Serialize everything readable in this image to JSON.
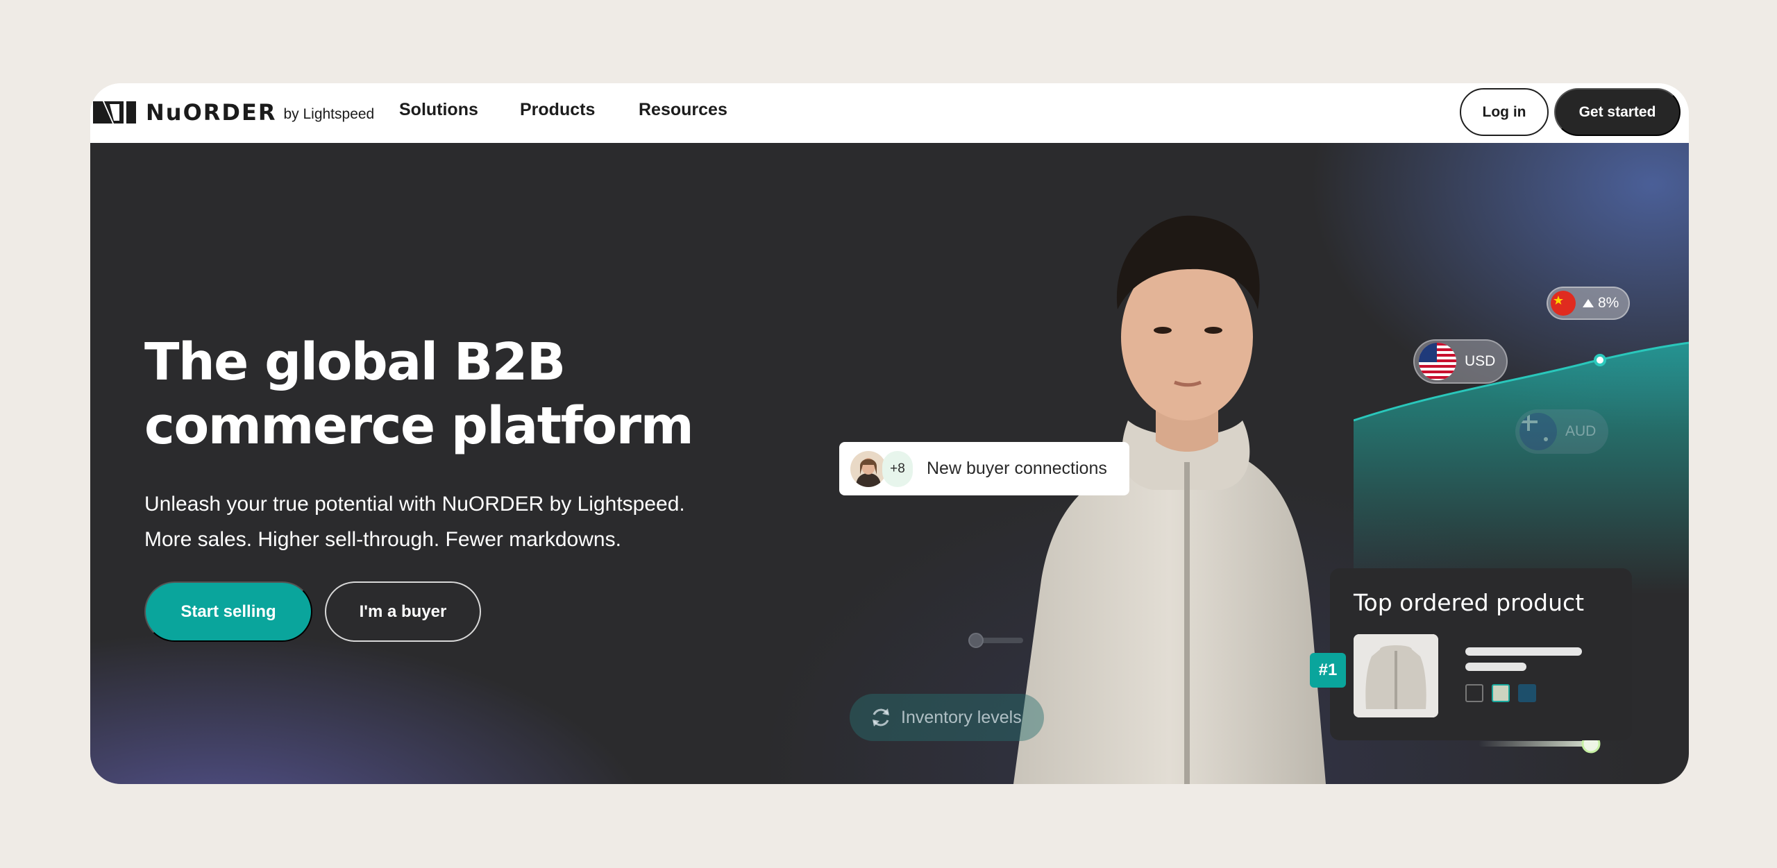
{
  "brand": {
    "name": "NuORDER",
    "suffix": "by Lightspeed"
  },
  "nav": {
    "links": [
      "Solutions",
      "Products",
      "Resources"
    ],
    "login_label": "Log in",
    "get_started_label": "Get started"
  },
  "hero": {
    "title_line1": "The global B2B",
    "title_line2": "commerce platform",
    "subtitle_line1": "Unleash your true potential with NuORDER by Lightspeed.",
    "subtitle_line2": "More sales. Higher sell-through. Fewer markdowns.",
    "primary_cta": "Start selling",
    "secondary_cta": "I'm a buyer"
  },
  "widgets": {
    "buyer_connections": {
      "count": "+8",
      "label": "New buyer connections"
    },
    "currency_usd": "USD",
    "currency_aud": "AUD",
    "china_change": "8%",
    "inventory": "Inventory levels",
    "top_product": {
      "title": "Top ordered product",
      "rank": "#1"
    }
  },
  "colors": {
    "accent": "#0aa59c",
    "dark": "#262626",
    "hero_bg": "#2b2b2d",
    "page_bg": "#efebe6"
  },
  "icons": [
    "logo-mark-icon",
    "us-flag-icon",
    "china-flag-icon",
    "australia-flag-icon",
    "refresh-icon",
    "up-arrow-icon"
  ]
}
